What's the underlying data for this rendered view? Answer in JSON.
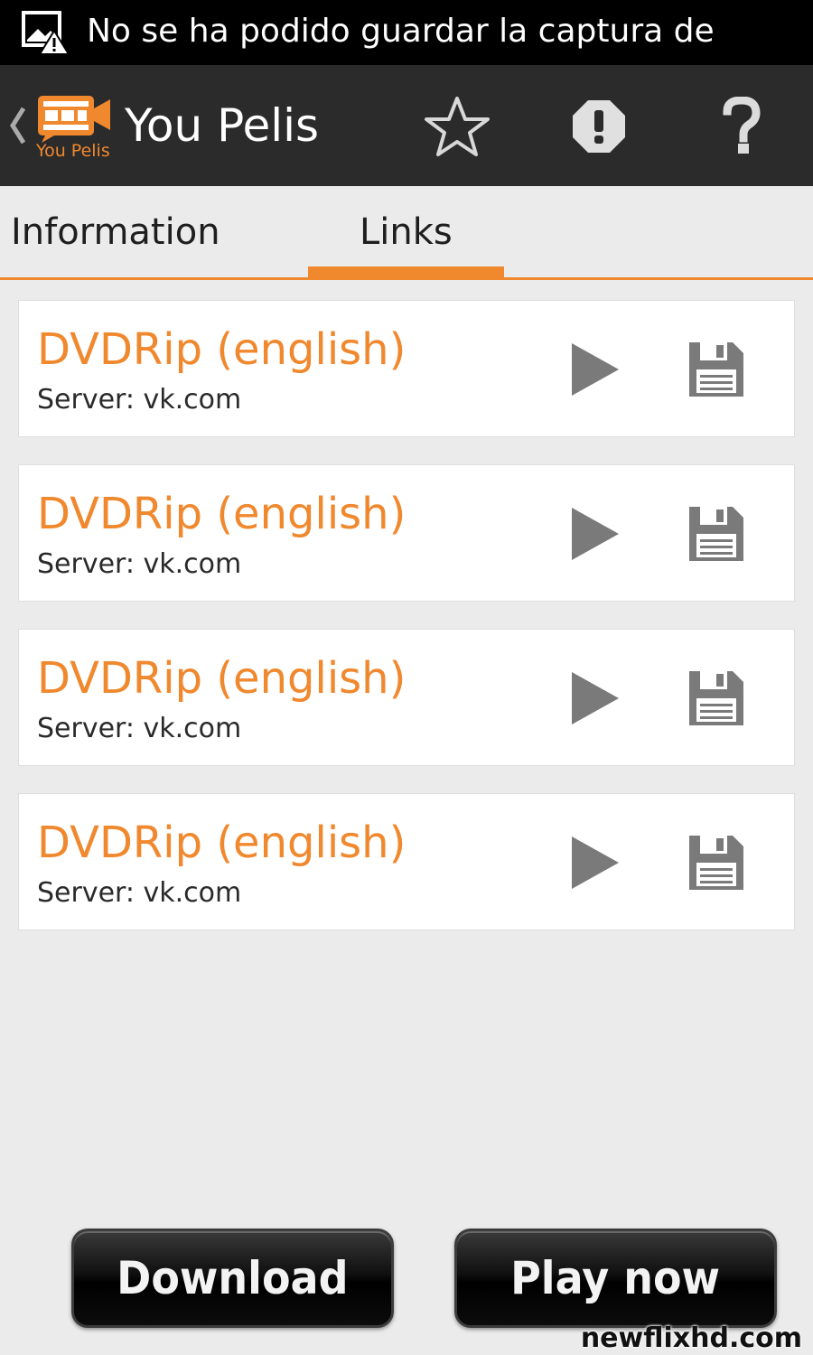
{
  "status_bar": {
    "notification_text": "No se ha podido guardar la captura de",
    "icon": "screenshot-warning-icon"
  },
  "action_bar": {
    "app_title": "You Pelis",
    "logo_text": "You Pelis",
    "back_icon": "chevron-left-icon",
    "actions": [
      {
        "name": "favorite",
        "icon": "star-outline-icon"
      },
      {
        "name": "report",
        "icon": "exclamation-octagon-icon"
      },
      {
        "name": "help",
        "icon": "question-mark-icon"
      }
    ]
  },
  "tabs": [
    {
      "label": "Information",
      "selected": false
    },
    {
      "label": "Links",
      "selected": true
    }
  ],
  "links": [
    {
      "title": "DVDRip (english)",
      "server": "Server: vk.com"
    },
    {
      "title": "DVDRip (english)",
      "server": "Server: vk.com"
    },
    {
      "title": "DVDRip (english)",
      "server": "Server: vk.com"
    },
    {
      "title": "DVDRip (english)",
      "server": "Server: vk.com"
    }
  ],
  "footer": {
    "download_label": "Download",
    "play_label": "Play now"
  },
  "watermark": "newflixhd.com",
  "colors": {
    "accent": "#f0882e",
    "action_bar": "#2b2b2b",
    "background": "#ebebeb",
    "icon_gray": "#7a7a7a"
  }
}
